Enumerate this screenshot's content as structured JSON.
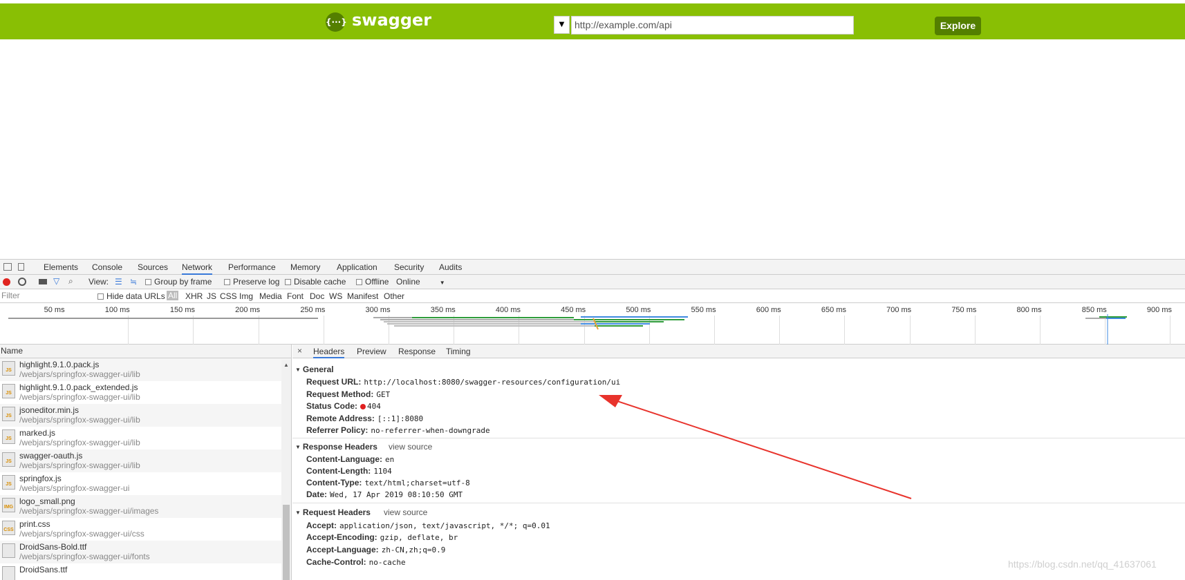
{
  "swagger": {
    "logo_glyph": "{···}",
    "title": "swagger",
    "select_arrow": "▼",
    "url_value": "http://example.com/api",
    "explore_label": "Explore",
    "brand_color": "#89bf04"
  },
  "devtools": {
    "tabs": [
      "Elements",
      "Console",
      "Sources",
      "Network",
      "Performance",
      "Memory",
      "Application",
      "Security",
      "Audits"
    ],
    "active_tab": "Network",
    "toolbar": {
      "view_label": "View:",
      "group_by_frame": "Group by frame",
      "preserve_log": "Preserve log",
      "disable_cache": "Disable cache",
      "offline": "Offline",
      "online": "Online",
      "online_arrow": "▼"
    },
    "filter": {
      "placeholder": "Filter",
      "hide_data_urls": "Hide data URLs",
      "types": [
        "All",
        "XHR",
        "JS",
        "CSS",
        "Img",
        "Media",
        "Font",
        "Doc",
        "WS",
        "Manifest",
        "Other"
      ]
    },
    "timeline_ticks": [
      "50 ms",
      "100 ms",
      "150 ms",
      "200 ms",
      "250 ms",
      "300 ms",
      "350 ms",
      "400 ms",
      "450 ms",
      "500 ms",
      "550 ms",
      "600 ms",
      "650 ms",
      "700 ms",
      "750 ms",
      "800 ms",
      "850 ms",
      "900 ms"
    ],
    "list": {
      "header": "Name",
      "rows": [
        {
          "name": "highlight.9.1.0.pack.js",
          "path": "/webjars/springfox-swagger-ui/lib",
          "icon": "JS"
        },
        {
          "name": "highlight.9.1.0.pack_extended.js",
          "path": "/webjars/springfox-swagger-ui/lib",
          "icon": "JS"
        },
        {
          "name": "jsoneditor.min.js",
          "path": "/webjars/springfox-swagger-ui/lib",
          "icon": "JS"
        },
        {
          "name": "marked.js",
          "path": "/webjars/springfox-swagger-ui/lib",
          "icon": "JS"
        },
        {
          "name": "swagger-oauth.js",
          "path": "/webjars/springfox-swagger-ui/lib",
          "icon": "JS"
        },
        {
          "name": "springfox.js",
          "path": "/webjars/springfox-swagger-ui",
          "icon": "JS"
        },
        {
          "name": "logo_small.png",
          "path": "/webjars/springfox-swagger-ui/images",
          "icon": "IMG"
        },
        {
          "name": "print.css",
          "path": "/webjars/springfox-swagger-ui/css",
          "icon": "CSS"
        },
        {
          "name": "DroidSans-Bold.ttf",
          "path": "/webjars/springfox-swagger-ui/fonts",
          "icon": ""
        },
        {
          "name": "DroidSans.ttf",
          "path": "",
          "icon": ""
        }
      ]
    },
    "detail": {
      "close": "×",
      "tabs": [
        "Headers",
        "Preview",
        "Response",
        "Timing"
      ],
      "general": {
        "title": "General",
        "request_url_k": "Request URL:",
        "request_url_v": "http://localhost:8080/swagger-resources/configuration/ui",
        "request_method_k": "Request Method:",
        "request_method_v": "GET",
        "status_code_k": "Status Code:",
        "status_code_v": "404",
        "remote_address_k": "Remote Address:",
        "remote_address_v": "[::1]:8080",
        "referrer_policy_k": "Referrer Policy:",
        "referrer_policy_v": "no-referrer-when-downgrade"
      },
      "response_headers": {
        "title": "Response Headers",
        "view_source": "view source",
        "content_language_k": "Content-Language:",
        "content_language_v": "en",
        "content_length_k": "Content-Length:",
        "content_length_v": "1104",
        "content_type_k": "Content-Type:",
        "content_type_v": "text/html;charset=utf-8",
        "date_k": "Date:",
        "date_v": "Wed, 17 Apr 2019 08:10:50 GMT"
      },
      "request_headers": {
        "title": "Request Headers",
        "view_source": "view source",
        "accept_k": "Accept:",
        "accept_v": "application/json, text/javascript, */*; q=0.01",
        "accept_encoding_k": "Accept-Encoding:",
        "accept_encoding_v": "gzip, deflate, br",
        "accept_language_k": "Accept-Language:",
        "accept_language_v": "zh-CN,zh;q=0.9",
        "cache_control_k": "Cache-Control:",
        "cache_control_v": "no-cache"
      }
    }
  },
  "watermark": "https://blog.csdn.net/qq_41637061"
}
